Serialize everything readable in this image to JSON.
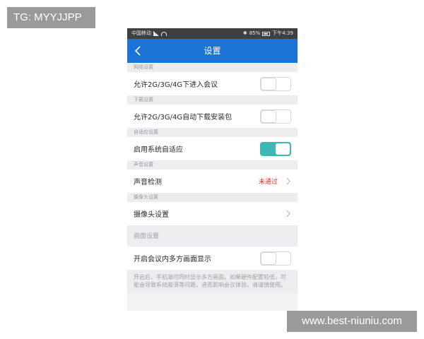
{
  "overlay": {
    "tag": "TG: MYYJJPP",
    "watermark": "www.best-niuniu.com"
  },
  "status_bar": {
    "carrier": "中国移动",
    "battery": "85%",
    "time": "下午4:39"
  },
  "nav": {
    "title": "设置"
  },
  "sections": {
    "network": {
      "header": "网络设置",
      "row_label": "允许2G/3G/4G下进入会议",
      "toggle_on": false
    },
    "download": {
      "header": "下载设置",
      "row_label": "允许2G/3G/4G自动下载安装包",
      "toggle_on": false
    },
    "adaptive": {
      "header": "自适应设置",
      "row_label": "启用系统自适应",
      "toggle_on": true
    },
    "audio": {
      "header": "声音设置",
      "row_label": "声音检测",
      "row_value": "未通过"
    },
    "camera": {
      "header": "摄像头设置",
      "row_label": "摄像头设置"
    },
    "screen": {
      "header": "画面设置",
      "row_label": "开启会议内多方画面显示",
      "toggle_on": false,
      "note": "开启后，手机端可同时显示多方画面。如果硬件配置较低，可能会导致系统崩溃等问题，进而影响会议体验，请谨慎使用。"
    }
  },
  "colors": {
    "nav_bar": "#1b73d6",
    "toggle_on": "#3fb7b5",
    "warning_text": "#c0392b"
  }
}
